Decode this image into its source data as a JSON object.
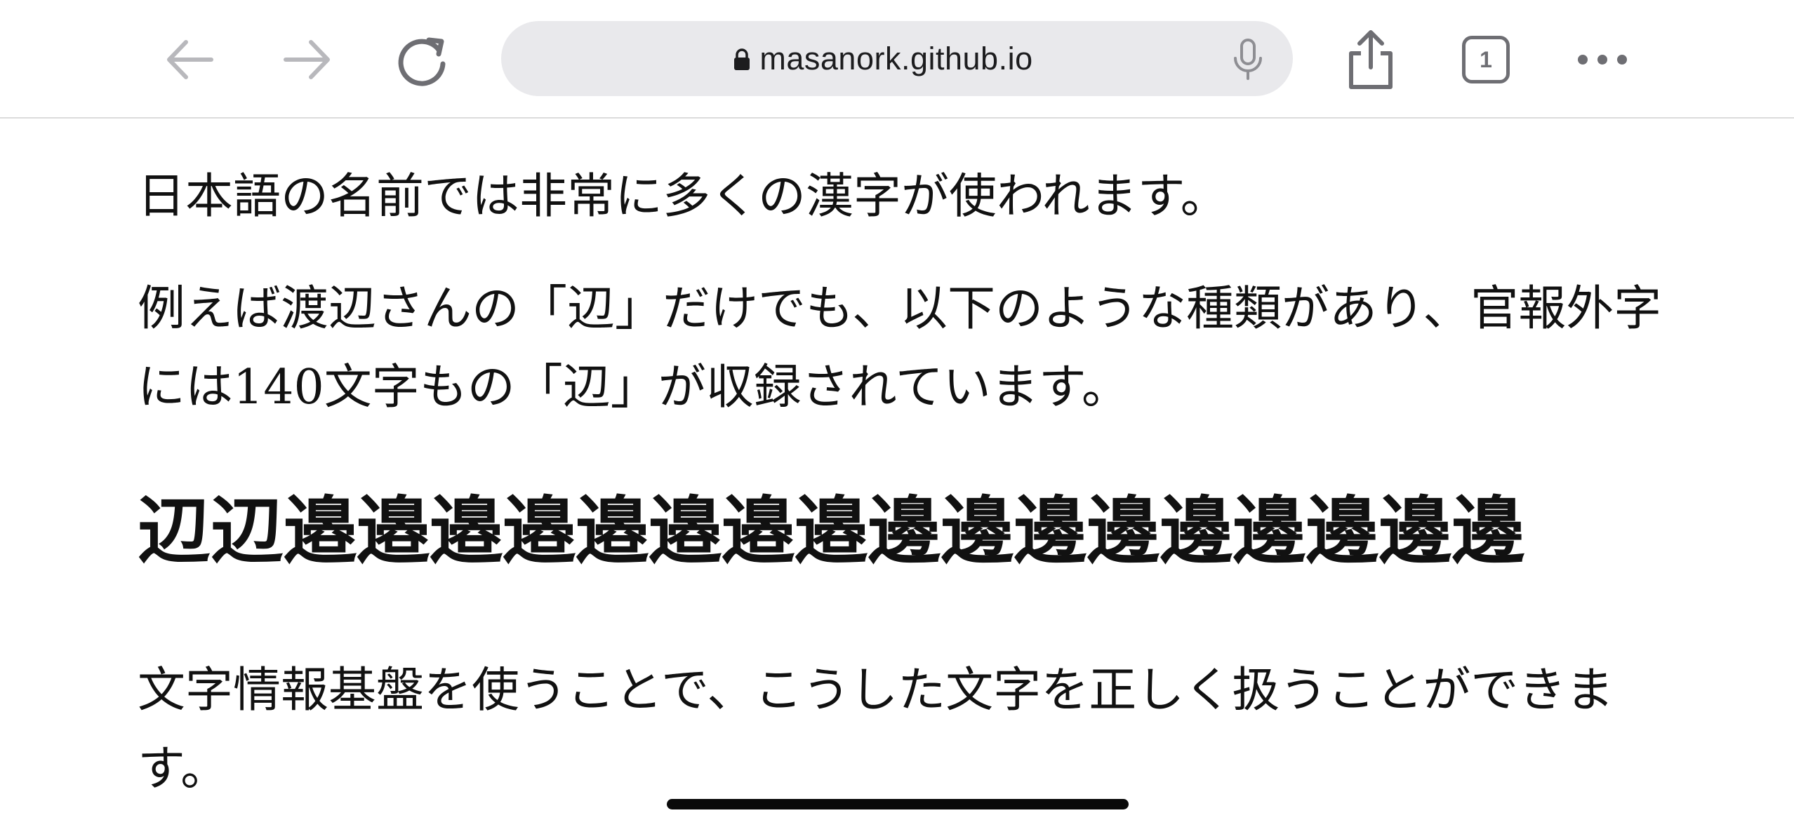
{
  "browser": {
    "url": "masanork.github.io",
    "tab_count": "1",
    "icons": {
      "back": "arrow-left-icon",
      "forward": "arrow-right-icon",
      "reload": "reload-icon",
      "lock": "lock-icon",
      "mic": "microphone-icon",
      "share": "share-icon",
      "tabs": "tabs-icon",
      "more": "ellipsis-icon"
    },
    "colors": {
      "toolbar_bg": "#ffffff",
      "address_bar_bg": "#e9e9ec",
      "icon_disabled": "#b8b8bc",
      "icon_active": "#6e6e73",
      "text": "#111111"
    }
  },
  "page": {
    "paragraph_1": "日本語の名前では非常に多くの漢字が使われます。",
    "paragraph_2": "例えば渡辺さんの「辺」だけでも、以下のような種類があり、官報外字には140文字もの「辺」が収録されています。",
    "kanji_list": "辺辺邉邉邉邉邉邉邉邉邊邊邊邊邊邊邊邊邊",
    "paragraph_3": "文字情報基盤を使うことで、こうした文字を正しく扱うことができます。"
  }
}
